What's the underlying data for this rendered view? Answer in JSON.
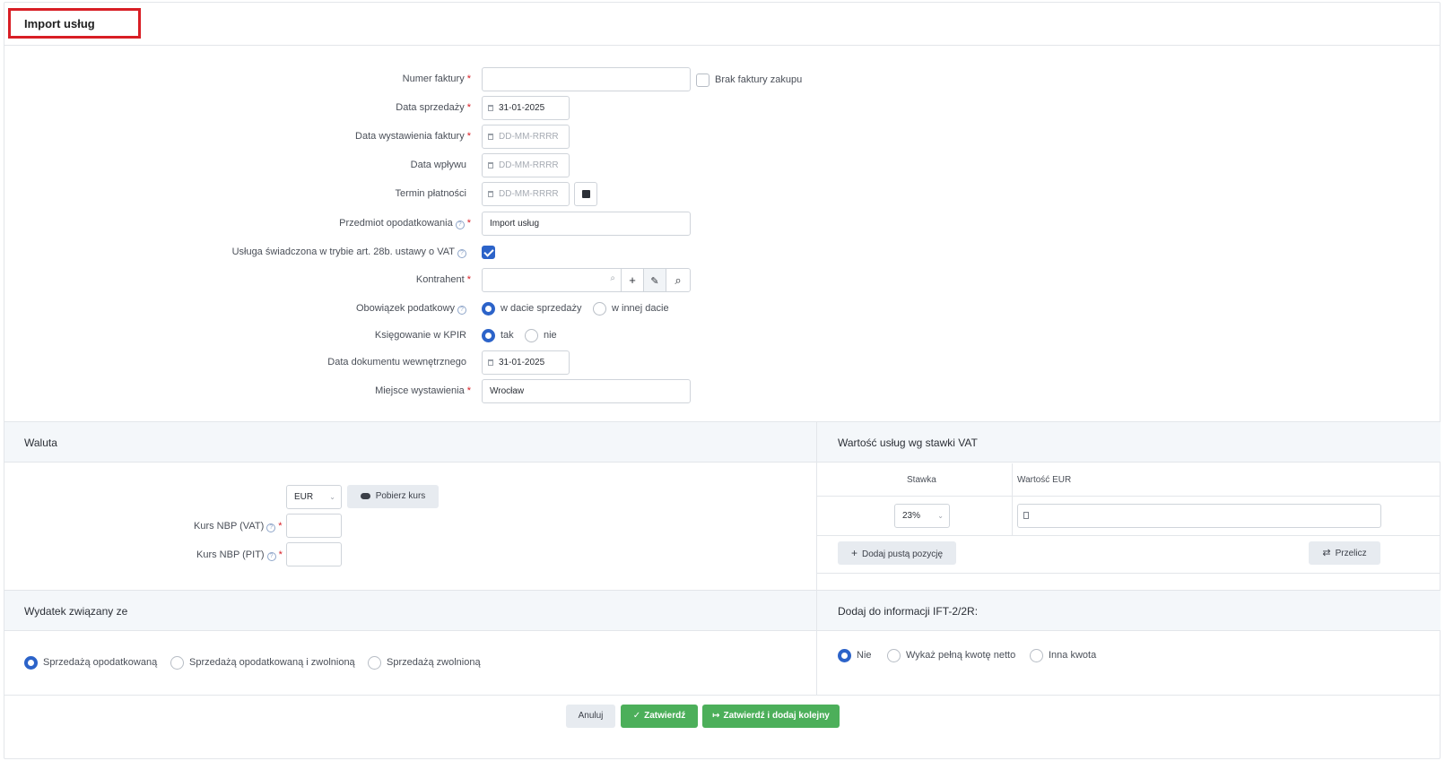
{
  "page": {
    "title": "Import usług"
  },
  "form": {
    "invoice_number_label": "Numer faktury",
    "invoice_number_value": "",
    "no_invoice_label": "Brak faktury zakupu",
    "sale_date_label": "Data sprzedaży",
    "sale_date_value": "31-01-2025",
    "issue_date_label": "Data wystawienia faktury",
    "issue_date_placeholder": "DD-MM-RRRR",
    "receipt_date_label": "Data wpływu",
    "receipt_date_placeholder": "DD-MM-RRRR",
    "payment_due_label": "Termin płatności",
    "payment_due_placeholder": "DD-MM-RRRR",
    "subject_label": "Przedmiot opodatkowania",
    "subject_value": "Import usług",
    "art28b_label": "Usługa świadczona w trybie art. 28b. ustawy o VAT",
    "art28b_checked": true,
    "contractor_label": "Kontrahent",
    "contractor_value": "",
    "tax_obligation_label": "Obowiązek podatkowy",
    "tax_obligation_options": [
      "w dacie sprzedaży",
      "w innej dacie"
    ],
    "kpir_label": "Księgowanie w KPIR",
    "kpir_options": [
      "tak",
      "nie"
    ],
    "internal_doc_date_label": "Data dokumentu wewnętrznego",
    "internal_doc_date_value": "31-01-2025",
    "place_label": "Miejsce wystawienia",
    "place_value": "Wrocław",
    "required_mark": "*",
    "help_mark": "?"
  },
  "currency": {
    "section_title": "Waluta",
    "selected": "EUR",
    "fetch_rate_label": "Pobierz kurs",
    "nbp_vat_label": "Kurs NBP (VAT)",
    "nbp_pit_label": "Kurs NBP (PIT)",
    "nbp_vat_value": "",
    "nbp_pit_value": ""
  },
  "vat_values": {
    "section_title": "Wartość usług wg stawki VAT",
    "col_rate": "Stawka",
    "col_value": "Wartość EUR",
    "rate_value": "23%",
    "amount_value": "",
    "add_row_label": "Dodaj pustą pozycję",
    "recalc_label": "Przelicz"
  },
  "expense": {
    "section_title": "Wydatek związany ze",
    "options": [
      "Sprzedażą opodatkowaną",
      "Sprzedażą opodatkowaną i zwolnioną",
      "Sprzedażą zwolnioną"
    ]
  },
  "ift": {
    "section_title": "Dodaj do informacji IFT-2/2R:",
    "options": [
      "Nie",
      "Wykaż pełną kwotę netto",
      "Inna kwota"
    ]
  },
  "footer": {
    "cancel_label": "Anuluj",
    "confirm_label": "Zatwierdź",
    "confirm_next_label": "Zatwierdź i dodaj kolejny"
  },
  "colors": {
    "accent": "#2c63c9",
    "success": "#4caf5a",
    "required": "#d81e25",
    "highlight_frame": "#d81e25"
  }
}
